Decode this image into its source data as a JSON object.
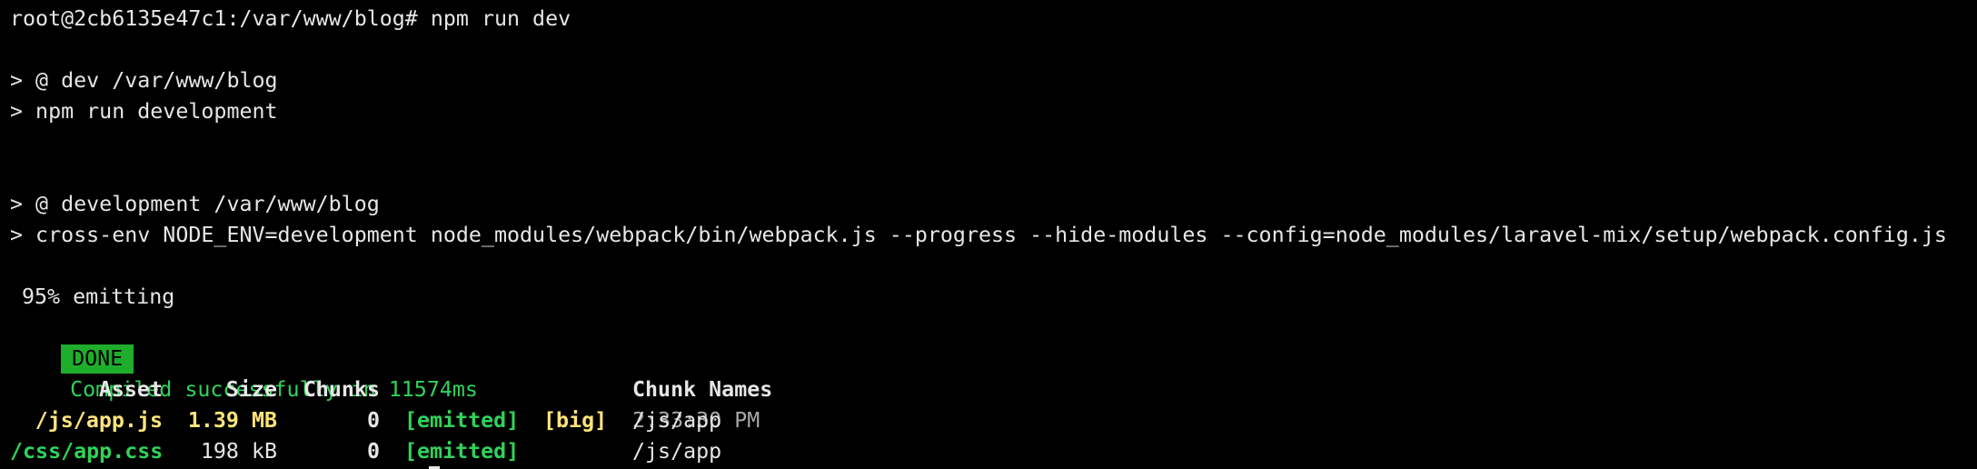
{
  "terminal": {
    "prompt_line": "root@2cb6135e47c1:/var/www/blog# npm run dev",
    "script_lines": [
      "> @ dev /var/www/blog",
      "> npm run development",
      "> @ development /var/www/blog",
      "> cross-env NODE_ENV=development node_modules/webpack/bin/webpack.js --progress --hide-modules --config=node_modules/laravel-mix/setup/webpack.config.js"
    ],
    "progress": "95% emitting",
    "done_badge": "DONE",
    "compiled_message": "Compiled successfully in 11574ms",
    "timestamp": "2:33:30 PM",
    "table": {
      "headers": {
        "asset": "Asset",
        "size": "Size",
        "chunks": "Chunks",
        "chunk_names": "Chunk Names"
      },
      "rows": [
        {
          "asset": "/js/app.js",
          "size": "1.39 MB",
          "chunks": "0",
          "status": "[emitted]",
          "flag": "[big]",
          "chunk_names": "/js/app"
        },
        {
          "asset": "/css/app.css",
          "size": "198 kB",
          "chunks": "0",
          "status": "[emitted]",
          "flag": "",
          "chunk_names": "/js/app"
        }
      ]
    }
  },
  "colors": {
    "background": "#000000",
    "text": "#e6e6e6",
    "green": "#30d35a",
    "badge": "#1fae2c",
    "yellow": "#ffe47a"
  }
}
